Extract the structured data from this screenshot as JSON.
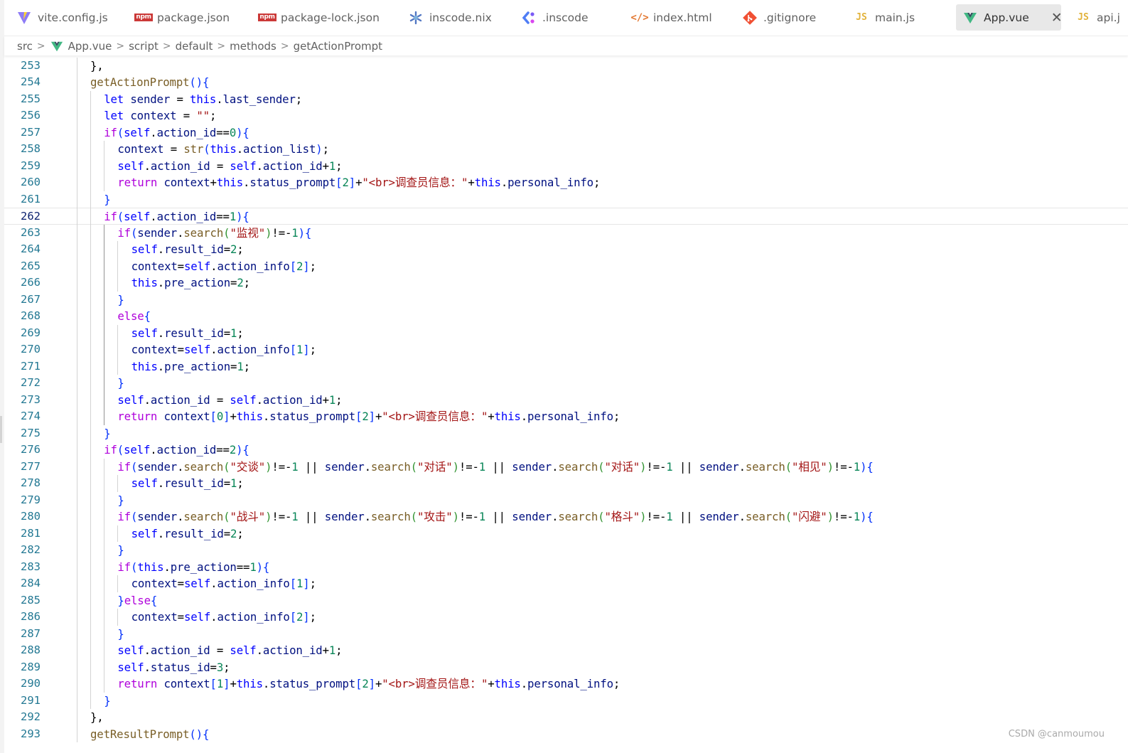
{
  "tabs": [
    {
      "label": "vite.config.js",
      "icon": "vite-icon"
    },
    {
      "label": "package.json",
      "icon": "npm-icon"
    },
    {
      "label": "package-lock.json",
      "icon": "npm-icon"
    },
    {
      "label": "inscode.nix",
      "icon": "nix-icon"
    },
    {
      "label": ".inscode",
      "icon": "inscode-icon"
    },
    {
      "label": "index.html",
      "icon": "html-icon"
    },
    {
      "label": ".gitignore",
      "icon": "git-icon"
    },
    {
      "label": "main.js",
      "icon": "js-icon"
    },
    {
      "label": "App.vue",
      "icon": "vue-icon",
      "active": true,
      "close_glyph": "✕"
    },
    {
      "label": "api.j",
      "icon": "js-icon"
    }
  ],
  "breadcrumb": {
    "items": [
      "src",
      "App.vue",
      "script",
      "default",
      "methods",
      "getActionPrompt"
    ],
    "separator": ">"
  },
  "editor": {
    "current_line": 262,
    "lines": [
      {
        "n": "253",
        "code": "},"
      },
      {
        "n": "254",
        "code": "getActionPrompt(){"
      },
      {
        "n": "255",
        "code": "let sender = this.last_sender;"
      },
      {
        "n": "256",
        "code": "let context = \"\";"
      },
      {
        "n": "257",
        "code": "if(self.action_id==0){"
      },
      {
        "n": "258",
        "code": "context = str(this.action_list);"
      },
      {
        "n": "259",
        "code": "self.action_id = self.action_id+1;"
      },
      {
        "n": "260",
        "code": "return context+this.status_prompt[2]+\"<br>调查员信息：\"+this.personal_info;"
      },
      {
        "n": "261",
        "code": "}"
      },
      {
        "n": "262",
        "code": "if(self.action_id==1){"
      },
      {
        "n": "263",
        "code": "if(sender.search(\"监视\")!=-1){"
      },
      {
        "n": "264",
        "code": "self.result_id=2;"
      },
      {
        "n": "265",
        "code": "context=self.action_info[2];"
      },
      {
        "n": "266",
        "code": "this.pre_action=2;"
      },
      {
        "n": "267",
        "code": "}"
      },
      {
        "n": "268",
        "code": "else{"
      },
      {
        "n": "269",
        "code": "self.result_id=1;"
      },
      {
        "n": "270",
        "code": "context=self.action_info[1];"
      },
      {
        "n": "271",
        "code": "this.pre_action=1;"
      },
      {
        "n": "272",
        "code": "}"
      },
      {
        "n": "273",
        "code": "self.action_id = self.action_id+1;"
      },
      {
        "n": "274",
        "code": "return context[0]+this.status_prompt[2]+\"<br>调查员信息：\"+this.personal_info;"
      },
      {
        "n": "275",
        "code": "}"
      },
      {
        "n": "276",
        "code": "if(self.action_id==2){"
      },
      {
        "n": "277",
        "code": "if(sender.search(\"交谈\")!=-1 || sender.search(\"对话\")!=-1 || sender.search(\"对话\")!=-1 || sender.search(\"相见\")!=-1){"
      },
      {
        "n": "278",
        "code": "self.result_id=1;"
      },
      {
        "n": "279",
        "code": "}"
      },
      {
        "n": "280",
        "code": "if(sender.search(\"战斗\")!=-1 || sender.search(\"攻击\")!=-1 || sender.search(\"格斗\")!=-1 || sender.search(\"闪避\")!=-1){"
      },
      {
        "n": "281",
        "code": "self.result_id=2;"
      },
      {
        "n": "282",
        "code": "}"
      },
      {
        "n": "283",
        "code": "if(this.pre_action==1){"
      },
      {
        "n": "284",
        "code": "context=self.action_info[1];"
      },
      {
        "n": "285",
        "code": "}else{"
      },
      {
        "n": "286",
        "code": "context=self.action_info[2];"
      },
      {
        "n": "287",
        "code": "}"
      },
      {
        "n": "288",
        "code": "self.action_id = self.action_id+1;"
      },
      {
        "n": "289",
        "code": "self.status_id=3;"
      },
      {
        "n": "290",
        "code": "return context[1]+this.status_prompt[2]+\"<br>调查员信息：\"+this.personal_info;"
      },
      {
        "n": "291",
        "code": "}"
      },
      {
        "n": "292",
        "code": "},"
      },
      {
        "n": "293",
        "code": "getResultPrompt(){"
      }
    ]
  },
  "watermark": "CSDN @canmoumou",
  "colors": {
    "keyword": "#0000ff",
    "control": "#af00db",
    "function": "#795e26",
    "variable": "#001080",
    "string": "#a31515",
    "number": "#098658",
    "line_number": "#237893",
    "bracket_level_1": "#0431fa",
    "bracket_level_2": "#319331",
    "bracket_level_3": "#7b3814"
  }
}
